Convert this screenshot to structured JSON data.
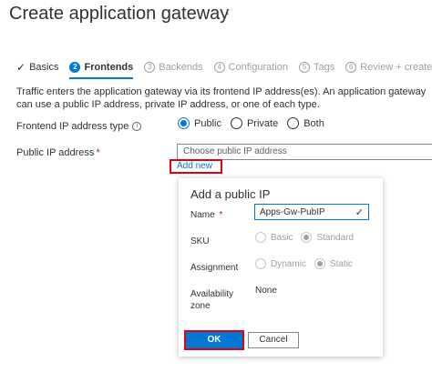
{
  "header": {
    "title": "Create application gateway",
    "more": "···"
  },
  "steps": [
    {
      "label": "Basics",
      "state": "done"
    },
    {
      "num": "2",
      "label": "Frontends",
      "state": "active"
    },
    {
      "num": "3",
      "label": "Backends",
      "state": "pending"
    },
    {
      "num": "4",
      "label": "Configuration",
      "state": "pending"
    },
    {
      "num": "5",
      "label": "Tags",
      "state": "pending"
    },
    {
      "num": "6",
      "label": "Review + create",
      "state": "pending"
    }
  ],
  "description": "Traffic enters the application gateway via its frontend IP address(es). An application gateway can use a public IP address, private IP address, or one of each type.",
  "frontend_type": {
    "label": "Frontend IP address type",
    "info": "i",
    "options": [
      "Public",
      "Private",
      "Both"
    ],
    "selected": "Public"
  },
  "public_ip": {
    "label": "Public IP address",
    "required": "*",
    "placeholder": "Choose public IP address",
    "add_new": "Add new"
  },
  "panel": {
    "title": "Add a public IP",
    "name_label": "Name",
    "name_required": "*",
    "name_value": "Apps-Gw-PubIP",
    "sku_label": "SKU",
    "sku_options": [
      "Basic",
      "Standard"
    ],
    "sku_selected": "Standard",
    "assignment_label": "Assignment",
    "assignment_options": [
      "Dynamic",
      "Static"
    ],
    "assignment_selected": "Static",
    "zone_label_line1": "Availability",
    "zone_label_line2": "zone",
    "zone_value": "None",
    "ok": "OK",
    "cancel": "Cancel"
  },
  "colors": {
    "accent": "#0078d4",
    "highlight": "#e3000f"
  }
}
